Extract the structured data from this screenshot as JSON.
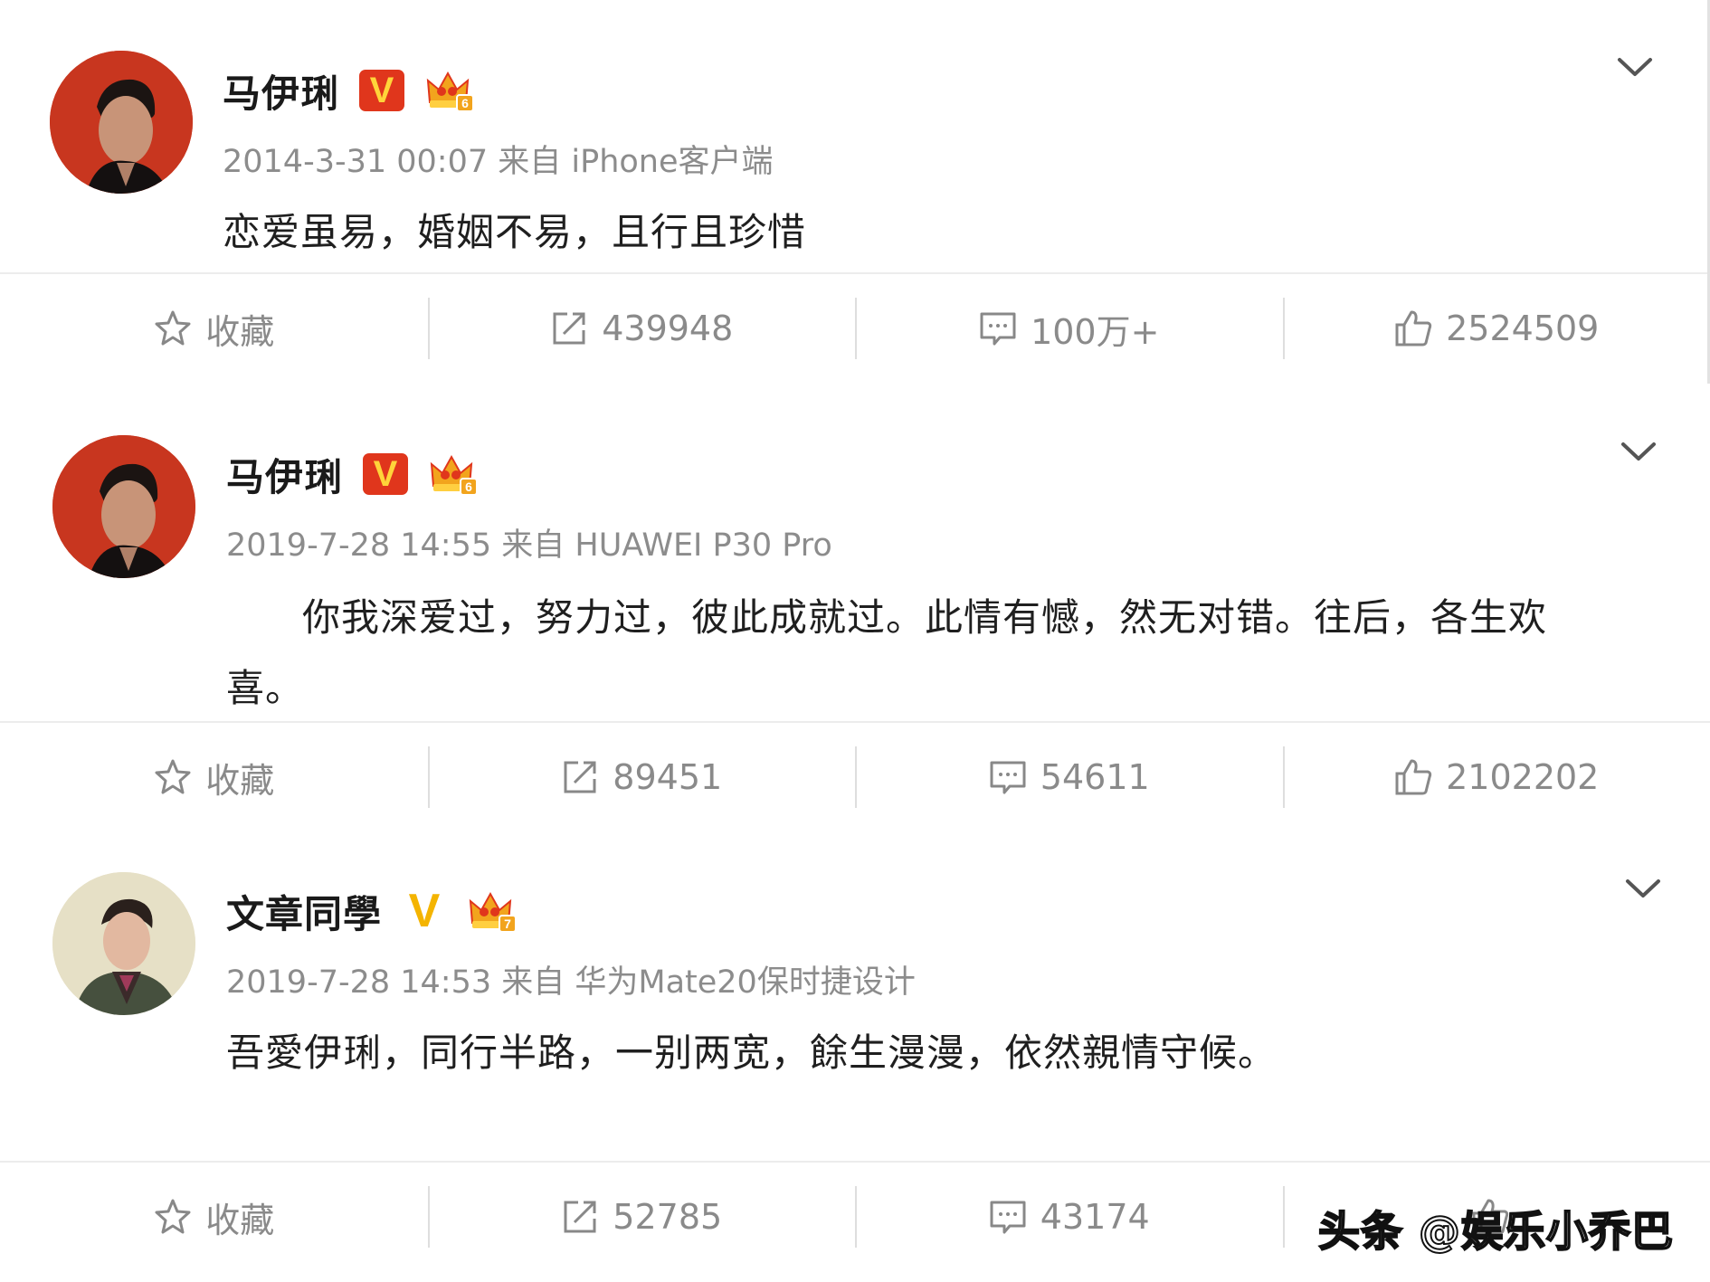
{
  "colors": {
    "verified_badge_bg": "#e0361c",
    "verified_badge_text": "#ffd43a",
    "meta_gray": "#8c8c8c",
    "action_gray": "#8a8a8a"
  },
  "posts": [
    {
      "user": {
        "name": "马伊琍",
        "verified_mark": "V",
        "crown_level": "6",
        "avatar_icon": "avatar-photo"
      },
      "meta": "2014-3-31 00:07 来自 iPhone客户端",
      "content": "恋爱虽易，婚姻不易，且行且珍惜",
      "actions": {
        "favorite": "收藏",
        "repost": "439948",
        "comment": "100万+",
        "like": "2524509"
      }
    },
    {
      "user": {
        "name": "马伊琍",
        "verified_mark": "V",
        "crown_level": "6",
        "avatar_icon": "avatar-photo"
      },
      "meta": "2019-7-28 14:55 来自 HUAWEI P30 Pro",
      "content": "你我深爱过，努力过，彼此成就过。此情有憾，然无对错。往后，各生欢喜。",
      "actions": {
        "favorite": "收藏",
        "repost": "89451",
        "comment": "54611",
        "like": "2102202"
      }
    },
    {
      "user": {
        "name": "文章同學",
        "verified_mark": "V",
        "crown_level": "7",
        "avatar_icon": "avatar-photo"
      },
      "meta": "2019-7-28 14:53 来自 华为Mate20保时捷设计",
      "content": "吾愛伊琍，同行半路，一别两宽，餘生漫漫，依然親情守候。",
      "actions": {
        "favorite": "收藏",
        "repost": "52785",
        "comment": "43174",
        "like": ""
      }
    }
  ],
  "watermark": "头条 @娱乐小乔巴"
}
